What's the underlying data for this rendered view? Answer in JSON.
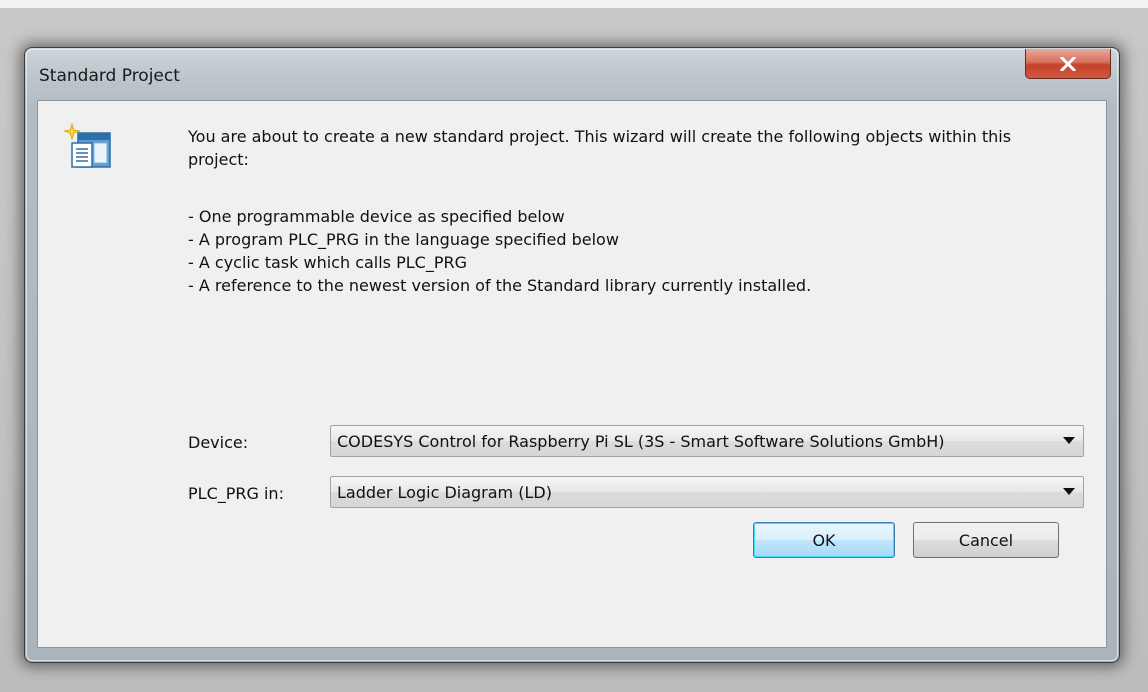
{
  "window": {
    "title": "Standard Project",
    "close_label": "x"
  },
  "intro": {
    "text": "You are about to create a new standard project. This wizard will create the following objects within this project:"
  },
  "bullets": [
    "- One programmable device as specified below",
    "- A program PLC_PRG in the language specified below",
    "- A cyclic task which calls PLC_PRG",
    "- A reference to the newest version of the Standard library currently installed."
  ],
  "form": {
    "device_label": "Device:",
    "device_value": "CODESYS Control for Raspberry Pi SL (3S - Smart Software Solutions GmbH)",
    "plc_label": "PLC_PRG in:",
    "plc_value": "Ladder Logic Diagram (LD)"
  },
  "buttons": {
    "ok_label": "OK",
    "cancel_label": "Cancel"
  },
  "icons": {
    "app": "new-project-wizard-icon",
    "close": "close-icon",
    "dropdown": "chevron-down-icon"
  }
}
